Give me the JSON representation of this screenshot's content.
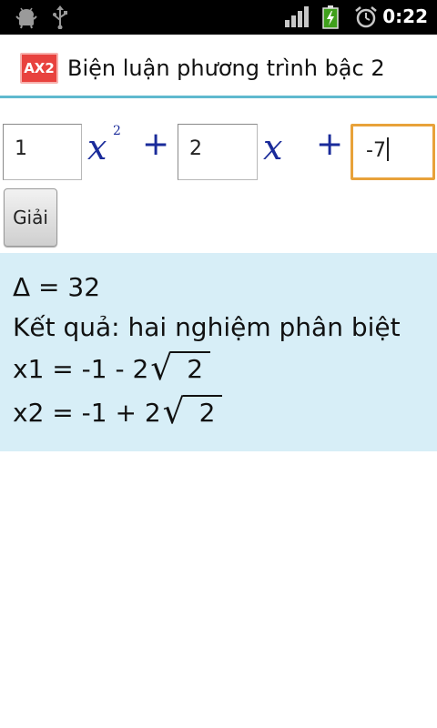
{
  "status_bar": {
    "time": "0:22",
    "icons": [
      "android-debug-icon",
      "usb-icon",
      "signal-icon",
      "battery-charging-icon",
      "alarm-icon"
    ]
  },
  "app": {
    "icon_text": "AX2",
    "title": "Biện luận phương trình bậc 2"
  },
  "equation": {
    "a": "1",
    "b": "2",
    "c": "-7",
    "var": "x",
    "exp": "2",
    "plus": "+"
  },
  "solve_button": {
    "label": "Giải"
  },
  "result": {
    "delta": "Δ = 32",
    "conclusion": "Kết quả: hai nghiệm phân biệt",
    "x1_prefix": "x1 = -1 - 2",
    "x1_radicand": "2",
    "x2_prefix": "x2 = -1 + 2",
    "x2_radicand": "2"
  },
  "colors": {
    "title_divider": "#5fb9cf",
    "result_background": "#d7eef7",
    "math_blue": "#1a2b9a",
    "focus_orange": "#e8a23a",
    "app_icon_red": "#e8423e"
  }
}
